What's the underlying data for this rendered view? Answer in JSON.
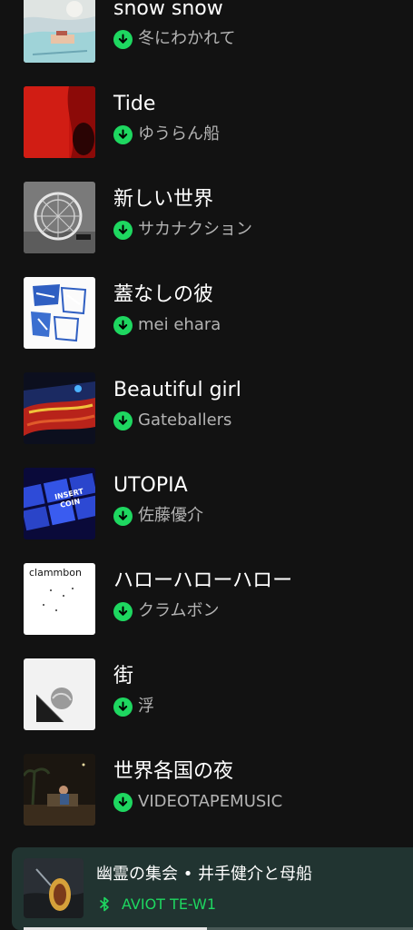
{
  "colors": {
    "background": "#121212",
    "accent_green": "#1ed760",
    "secondary_text": "#b3b3b3",
    "player_background": "#213431"
  },
  "tracks": [
    {
      "title": "snow snow",
      "artist": "冬にわかれて",
      "downloaded": true
    },
    {
      "title": "Tide",
      "artist": "ゆうらん船",
      "downloaded": true
    },
    {
      "title": "新しい世界",
      "artist": "サカナクション",
      "downloaded": true
    },
    {
      "title": "蓋なしの彼",
      "artist": "mei ehara",
      "downloaded": true
    },
    {
      "title": "Beautiful girl",
      "artist": "Gateballers",
      "downloaded": true
    },
    {
      "title": "UTOPIA",
      "artist": "佐藤優介",
      "downloaded": true
    },
    {
      "title": "ハローハローハロー",
      "artist": "クラムボン",
      "downloaded": true
    },
    {
      "title": "街",
      "artist": "浮",
      "downloaded": true
    },
    {
      "title": "世界各国の夜",
      "artist": "VIDEOTAPEMUSIC",
      "downloaded": true
    }
  ],
  "art_text": {
    "utopia_line1": "INSERT",
    "utopia_line2": "COIN",
    "clammbon_logo": "clammbon"
  },
  "now_playing": {
    "title": "幽霊の集会 • 井手健介と母船",
    "device_icon": "bluetooth-icon",
    "device": "AVIOT TE-W1",
    "progress": 0.47
  },
  "icons": {
    "download": "download-icon",
    "bluetooth": "bluetooth-icon"
  }
}
